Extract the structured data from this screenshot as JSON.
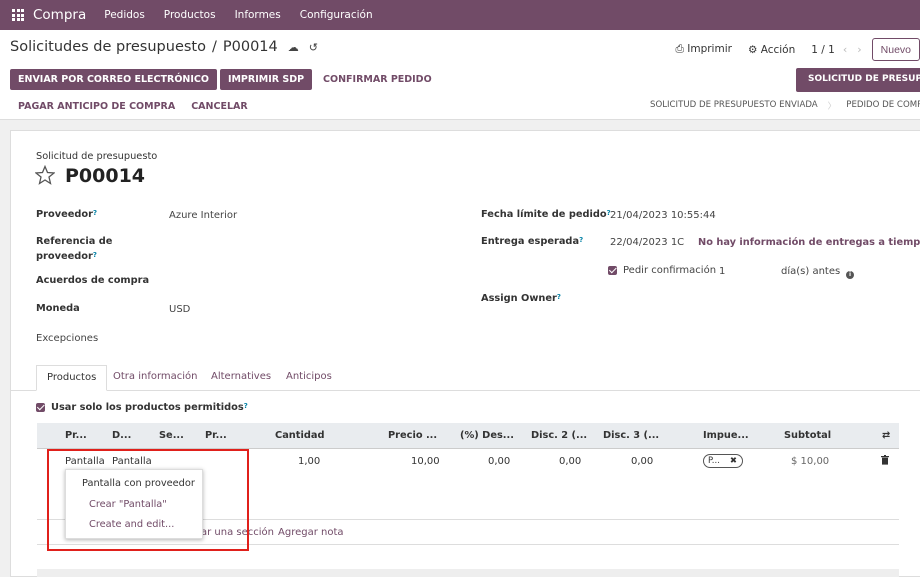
{
  "topbar": {
    "brand": "Compra",
    "menus": [
      "Pedidos",
      "Productos",
      "Informes",
      "Configuración"
    ]
  },
  "breadcrumb": {
    "parent": "Solicitudes de presupuesto",
    "current": "P00014"
  },
  "toolbar": {
    "print": "Imprimir",
    "action": "Acción",
    "pager": "1 / 1",
    "new": "Nuevo"
  },
  "actions": {
    "email": "ENVIAR POR CORREO ELECTRÓNICO",
    "print_sdp": "IMPRIMIR SDP",
    "confirm": "CONFIRMAR PEDIDO",
    "pay_advance": "PAGAR ANTICIPO DE COMPRA",
    "cancel": "CANCELAR",
    "right": "SOLICITUD DE PRESUPUESTO"
  },
  "status": {
    "sent": "SOLICITUD DE PRESUPUESTO ENVIADA",
    "order": "PEDIDO DE COMPRA"
  },
  "form": {
    "header_label": "Solicitud de presupuesto",
    "name": "P00014",
    "vendor_label": "Proveedor",
    "vendor_value": "Azure Interior",
    "ref_label_1": "Referencia de",
    "ref_label_2": "proveedor",
    "agreements_label": "Acuerdos de compra",
    "currency_label": "Moneda",
    "currency_value": "USD",
    "exceptions": "Excepciones",
    "deadline_label": "Fecha límite de pedido",
    "deadline_value": "21/04/2023 10:55:44",
    "expected_label": "Entrega esperada",
    "expected_value": "22/04/2023 1C",
    "no_delivery_info": "No hay información de entregas a tiempo",
    "ask_confirm_label": "Pedir confirmación",
    "ask_confirm_days": "1",
    "ask_confirm_suffix": "día(s) antes",
    "assign_owner": "Assign Owner"
  },
  "tabs": [
    "Productos",
    "Otra información",
    "Alternatives",
    "Anticipos"
  ],
  "products": {
    "only_products_label": "Usar solo los productos permitidos",
    "columns": [
      "Pr...",
      "D...",
      "Se...",
      "Pr...",
      "Cantidad",
      "Precio ...",
      "(%) Des...",
      "Disc. 2 (...",
      "Disc. 3 (...",
      "Impue...",
      "Subtotal"
    ],
    "row": {
      "product_input": "Pantalla",
      "description": "Pantalla",
      "quantity": "1,00",
      "price": "10,00",
      "discount": "0,00",
      "disc2": "0,00",
      "disc3": "0,00",
      "tax": "P...",
      "subtotal": "$ 10,00"
    },
    "add_section": "ar una sección",
    "add_note": "Agregar nota"
  },
  "dropdown": {
    "first": "Pantalla con proveedor",
    "create": "Crear \"Pantalla\"",
    "create_edit": "Create and edit..."
  },
  "colors": {
    "brand": "#714b67",
    "highlight": "#e0201b"
  }
}
